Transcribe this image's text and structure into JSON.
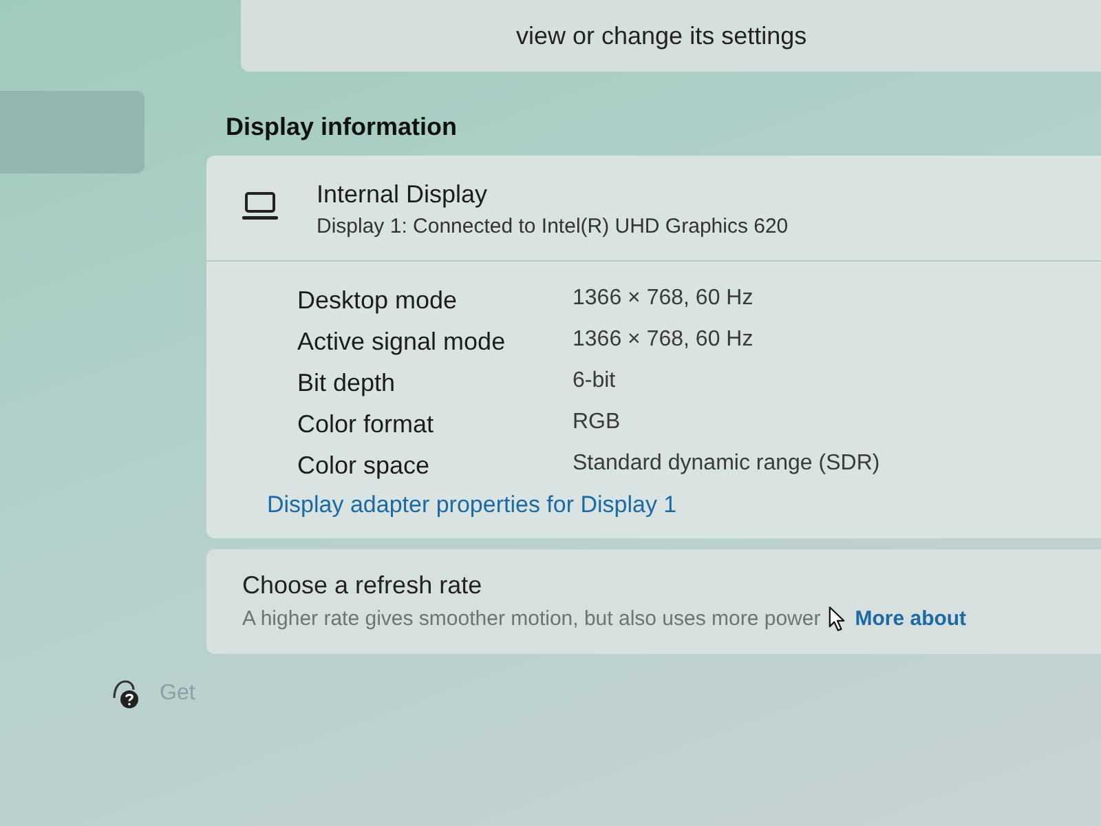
{
  "sidebar": {
    "items": [
      {
        "selected": true
      }
    ]
  },
  "top_card": {
    "text": "view or change its settings"
  },
  "section_title": "Display information",
  "display": {
    "name": "Internal Display",
    "description": "Display 1: Connected to Intel(R) UHD Graphics 620"
  },
  "properties": [
    {
      "label": "Desktop mode",
      "value": "1366 × 768, 60 Hz"
    },
    {
      "label": "Active signal mode",
      "value": "1366 × 768, 60 Hz"
    },
    {
      "label": "Bit depth",
      "value": "6-bit"
    },
    {
      "label": "Color format",
      "value": "RGB"
    },
    {
      "label": "Color space",
      "value": "Standard dynamic range (SDR)"
    }
  ],
  "adapter_link": "Display adapter properties for Display 1",
  "refresh_rate": {
    "title": "Choose a refresh rate",
    "description": "A higher rate gives smoother motion, but also uses more power",
    "link": "More about"
  },
  "help": {
    "label": "Get"
  }
}
